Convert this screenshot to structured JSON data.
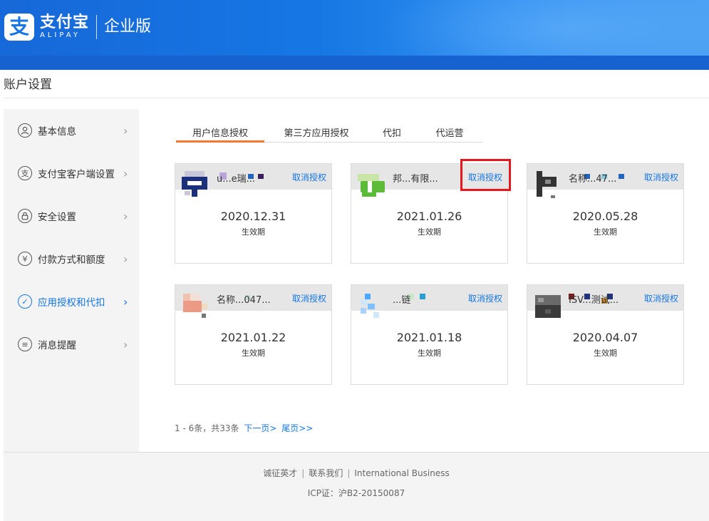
{
  "header": {
    "logo_glyph": "支",
    "brand_cn": "支付宝",
    "brand_en": "ALIPAY",
    "edition": "企业版",
    "colors": {
      "primary": "#1677e4",
      "band": "#1762d1"
    }
  },
  "page": {
    "title": "账户设置"
  },
  "sidebar": {
    "items": [
      {
        "label": "基本信息",
        "icon": "user-icon",
        "glyph": ""
      },
      {
        "label": "支付宝客户端设置",
        "icon": "alipay-icon",
        "glyph": "支"
      },
      {
        "label": "安全设置",
        "icon": "lock-icon",
        "glyph": ""
      },
      {
        "label": "付款方式和额度",
        "icon": "yen-icon",
        "glyph": "¥"
      },
      {
        "label": "应用授权和代扣",
        "icon": "check-icon",
        "glyph": "✓",
        "active": true
      },
      {
        "label": "消息提醒",
        "icon": "message-icon",
        "glyph": "≡"
      }
    ],
    "chevron": "›"
  },
  "tabs": [
    {
      "label": "用户信息授权",
      "active": true
    },
    {
      "label": "第三方应用授权"
    },
    {
      "label": "代扣"
    },
    {
      "label": "代运营"
    }
  ],
  "cards": [
    {
      "name": "u...e瑞...",
      "revoke": "取消授权",
      "date": "2020.12.31",
      "label": "生效期"
    },
    {
      "name": "邦...有限...",
      "revoke": "取消授权",
      "date": "2021.01.26",
      "label": "生效期"
    },
    {
      "name": "名称...47...",
      "revoke": "取消授权",
      "date": "2020.05.28",
      "label": "生效期"
    },
    {
      "name": "名称...047...",
      "revoke": "取消授权",
      "date": "2021.01.22",
      "label": "生效期"
    },
    {
      "name": "...链",
      "revoke": "取消授权",
      "date": "2021.01.18",
      "label": "生效期"
    },
    {
      "name": "ISV...测试...",
      "revoke": "取消授权",
      "date": "2020.04.07",
      "label": "生效期"
    }
  ],
  "pagination": {
    "summary": "1 - 6条，共33条",
    "next": "下一页>",
    "last": "尾页>>"
  },
  "footer": {
    "links": [
      "诚征英才",
      "联系我们",
      "International Business"
    ],
    "separator": "|",
    "icp": "ICP证：沪B2-20150087"
  }
}
